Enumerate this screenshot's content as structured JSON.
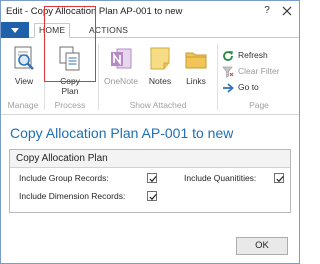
{
  "window": {
    "title": "Edit - Copy Allocation Plan AP-001 to new",
    "help_glyph": "?"
  },
  "tabs": {
    "home": "HOME",
    "actions": "ACTIONS"
  },
  "ribbon": {
    "view_label": "View",
    "copy_plan_label_1": "Copy",
    "copy_plan_label_2": "Plan",
    "onenote_label": "OneNote",
    "notes_label": "Notes",
    "links_label": "Links",
    "refresh_label": "Refresh",
    "clear_filter_label": "Clear Filter",
    "goto_label": "Go to",
    "group_manage": "Manage",
    "group_process": "Process",
    "group_show_attached": "Show Attached",
    "group_page": "Page"
  },
  "page": {
    "title": "Copy Allocation Plan AP-001 to new"
  },
  "fasttab": {
    "title": "Copy Allocation Plan",
    "fields": {
      "include_group_records": {
        "label": "Include Group Records:",
        "checked": true
      },
      "include_dimension_records": {
        "label": "Include Dimension Records:",
        "checked": true
      },
      "include_quantities": {
        "label": "Include Quanitities:",
        "checked": true
      }
    }
  },
  "footer": {
    "ok_label": "OK"
  },
  "colors": {
    "accent": "#1f6fb6",
    "app_menu": "#1f62ab",
    "highlight": "#e03535"
  }
}
